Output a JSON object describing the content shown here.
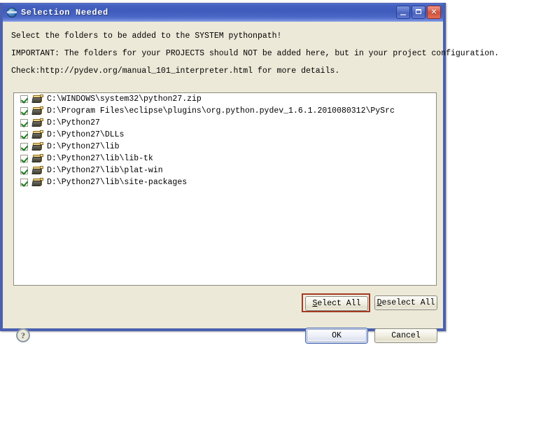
{
  "window": {
    "title": "Selection Needed",
    "icon": "globe-icon",
    "minimize_label": "_",
    "maximize_label": "□",
    "close_label": "✕"
  },
  "messages": {
    "line1": "Select the folders to be added to the SYSTEM pythonpath!",
    "line2": "IMPORTANT: The folders for your PROJECTS should NOT be added here, but in your project configuration.",
    "line3": "Check:http://pydev.org/manual_101_interpreter.html for more details."
  },
  "list": {
    "items": [
      {
        "checked": true,
        "path": "C:\\WINDOWS\\system32\\python27.zip"
      },
      {
        "checked": true,
        "path": "D:\\Program Files\\eclipse\\plugins\\org.python.pydev_1.6.1.2010080312\\PySrc"
      },
      {
        "checked": true,
        "path": "D:\\Python27"
      },
      {
        "checked": true,
        "path": "D:\\Python27\\DLLs"
      },
      {
        "checked": true,
        "path": "D:\\Python27\\lib"
      },
      {
        "checked": true,
        "path": "D:\\Python27\\lib\\lib-tk"
      },
      {
        "checked": true,
        "path": "D:\\Python27\\lib\\plat-win"
      },
      {
        "checked": true,
        "path": "D:\\Python27\\lib\\site-packages"
      }
    ]
  },
  "buttons": {
    "select_all": {
      "mnemonic": "S",
      "rest": "elect All"
    },
    "deselect_all": {
      "mnemonic": "D",
      "rest": "eselect All"
    },
    "ok": "OK",
    "cancel": "Cancel"
  },
  "help": {
    "glyph": "?"
  },
  "colors": {
    "dialog_background": "#ece9d8",
    "title_gradient_start": "#5f7ad4",
    "title_gradient_end": "#8fa3e6",
    "focus_ring": "#a33a22",
    "default_button_ring": "#3a5fb0",
    "check_green": "#1d7a1d",
    "close_button": "#d1503a"
  }
}
